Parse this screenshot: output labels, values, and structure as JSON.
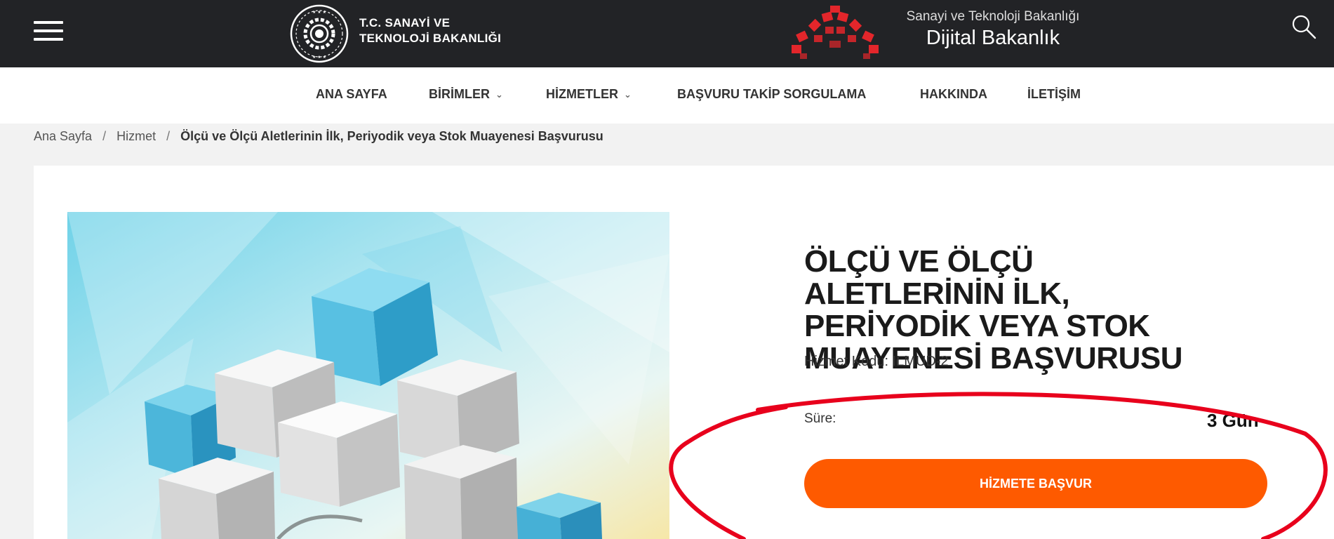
{
  "header": {
    "ministry_line1": "T.C. SANAYİ VE",
    "ministry_line2": "TEKNOLOJİ BAKANLIĞI",
    "digital_line1": "Sanayi ve Teknoloji Bakanlığı",
    "digital_line2": "Dijital Bakanlık",
    "bg_color": "#222326"
  },
  "nav": {
    "items": [
      {
        "label": "ANA SAYFA"
      },
      {
        "label": "BİRİMLER",
        "chevron": "⌄"
      },
      {
        "label": "HİZMETLER",
        "chevron": "⌄"
      },
      {
        "label": "BAŞVURU TAKİP SORGULAMA"
      },
      {
        "label": "HAKKINDA"
      },
      {
        "label": "İLETİŞİM"
      }
    ]
  },
  "breadcrumb": {
    "home": "Ana Sayfa",
    "section": "Hizmet",
    "current": "Ölçü ve Ölçü Aletlerinin İlk, Periyodik veya Stok Muayenesi Başvurusu",
    "separator": "/"
  },
  "service": {
    "title": "ÖLÇÜ VE ÖLÇÜ ALETLERİNİN İLK, PERİYODİK VEYA STOK MUAYENESİ BAŞVURUSU",
    "code_label": "Hizmet Kodu: ILMUD-2",
    "duration_label": "Süre:",
    "duration_value": "3 Gün",
    "apply_label": "HİZMETE BAŞVUR",
    "accent_color": "#fe5a00"
  },
  "annotation": {
    "color": "#e8001c"
  }
}
